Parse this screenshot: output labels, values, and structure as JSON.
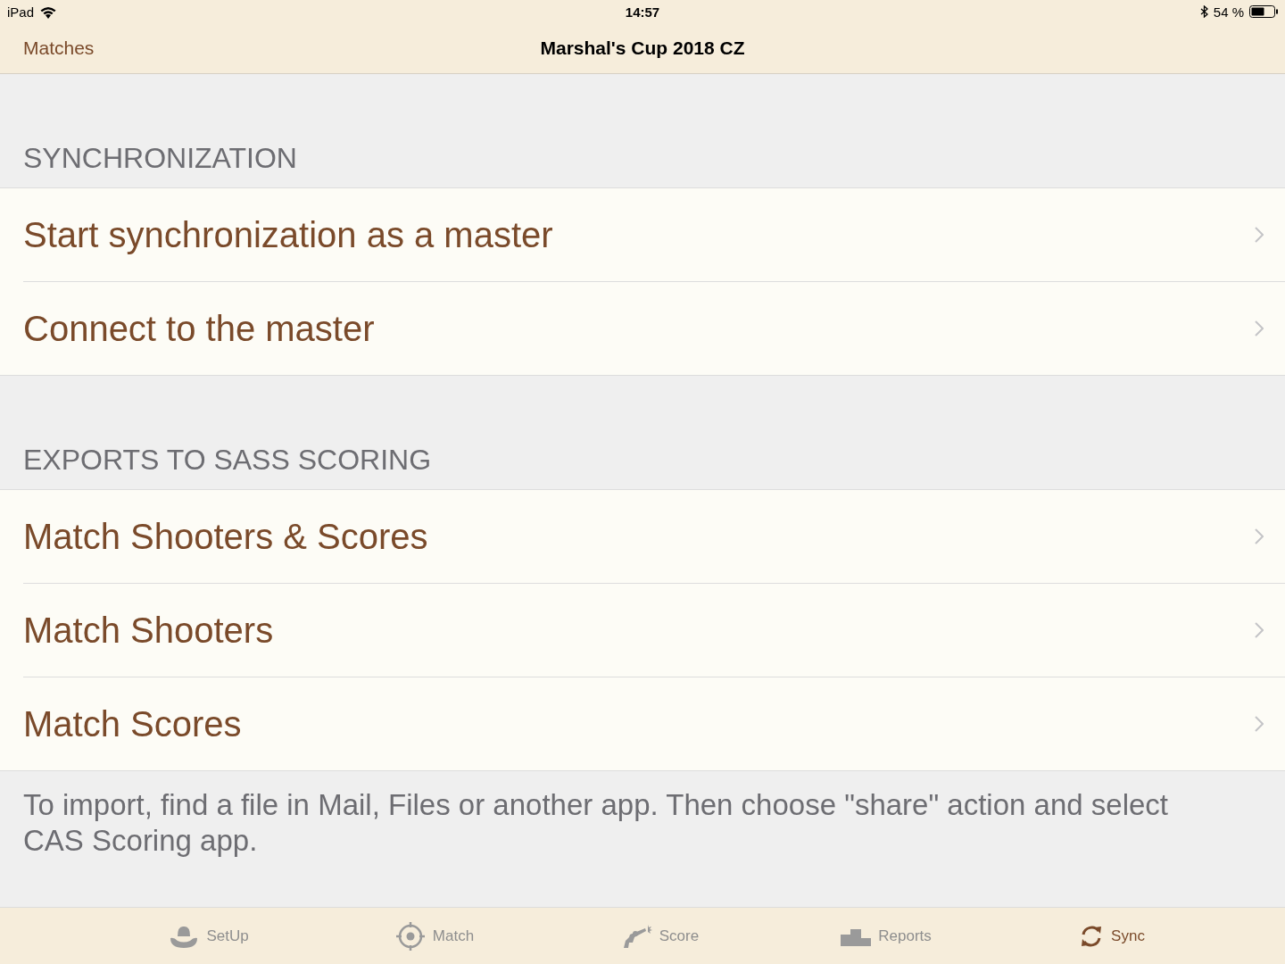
{
  "status_bar": {
    "device": "iPad",
    "time": "14:57",
    "battery": "54 %"
  },
  "nav": {
    "back": "Matches",
    "title": "Marshal's Cup 2018 CZ"
  },
  "sections": [
    {
      "header": "SYNCHRONIZATION",
      "items": [
        {
          "label": "Start synchronization as a master"
        },
        {
          "label": "Connect to the master"
        }
      ]
    },
    {
      "header": "EXPORTS TO SASS SCORING",
      "items": [
        {
          "label": "Match Shooters & Scores"
        },
        {
          "label": "Match Shooters"
        },
        {
          "label": "Match Scores"
        }
      ],
      "footer": "To import, find a file in Mail, Files or another app. Then choose \"share\" action and select CAS Scoring app."
    }
  ],
  "tabs": [
    {
      "kind": "hat",
      "label": "SetUp",
      "selected": false
    },
    {
      "kind": "target",
      "label": "Match",
      "selected": false
    },
    {
      "kind": "revolver",
      "label": "Score",
      "selected": false
    },
    {
      "kind": "podium",
      "label": "Reports",
      "selected": false
    },
    {
      "kind": "sync",
      "label": "Sync",
      "selected": true
    }
  ]
}
